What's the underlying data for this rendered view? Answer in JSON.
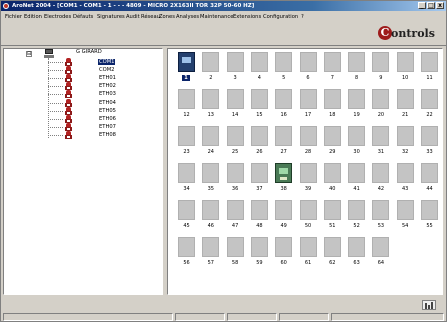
{
  "window": {
    "title": "AroNet 2004 - [COM1 - COM1 - 1 - - - 4809 - MICRO 2X163II TOR 32P 50-60 HZ]",
    "controls": {
      "minimize": "_",
      "maximize": "□",
      "close": "x"
    }
  },
  "menu": {
    "items": [
      "Fichier",
      "Edition",
      "Electrodes",
      "Défauts",
      "Signatures",
      "Audit",
      "Réseau",
      "Zones",
      "Analyses",
      "Maintenance",
      "Extensions",
      "Configuration",
      "?"
    ]
  },
  "brand": {
    "logo_mark": "C",
    "logo_text": "ontrols"
  },
  "tree": {
    "expander": "⊟",
    "root_label": "G GIRARD",
    "children": [
      "COM1",
      "COM2",
      "ETH01",
      "ETH02",
      "ETH03",
      "ETH04",
      "ETH05",
      "ETH06",
      "ETH07",
      "ETH08"
    ],
    "selected": "COM1"
  },
  "slots": {
    "numbers": [
      "1",
      "2",
      "3",
      "4",
      "5",
      "6",
      "7",
      "8",
      "9",
      "10",
      "11",
      "12",
      "13",
      "14",
      "15",
      "16",
      "17",
      "18",
      "19",
      "20",
      "21",
      "22",
      "23",
      "24",
      "25",
      "26",
      "27",
      "28",
      "29",
      "30",
      "31",
      "32",
      "33",
      "34",
      "35",
      "36",
      "37",
      "38",
      "39",
      "40",
      "41",
      "42",
      "43",
      "44",
      "45",
      "46",
      "47",
      "48",
      "49",
      "50",
      "51",
      "52",
      "53",
      "54",
      "55",
      "56",
      "57",
      "58",
      "59",
      "60",
      "61",
      "62",
      "63",
      "64"
    ],
    "selected": "1",
    "equipped": {
      "1": "blue-device",
      "38": "green-device"
    }
  },
  "status": {
    "icon": "chart-icon"
  }
}
